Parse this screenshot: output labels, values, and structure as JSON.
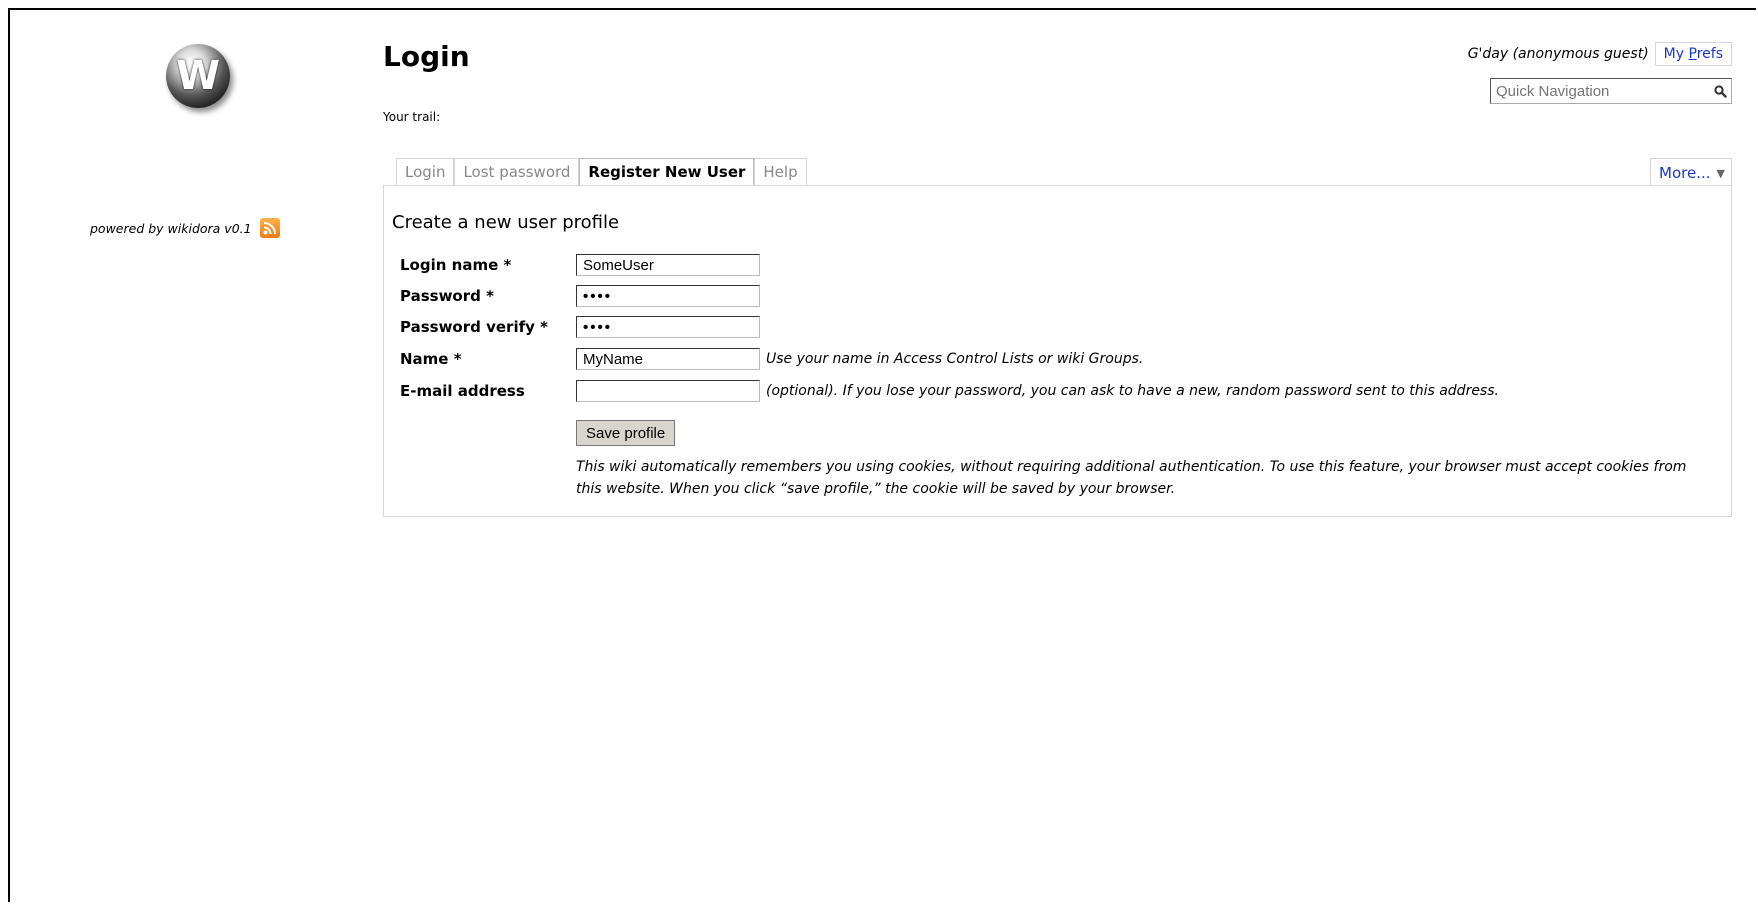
{
  "sidebar": {
    "logo_letter": "W",
    "powered_by": "powered by wikidora v0.1",
    "rss_icon": "rss-feed-icon"
  },
  "header": {
    "title": "Login",
    "trail_label": "Your trail:",
    "greeting": "G'day (anonymous guest)",
    "prefs_prefix": "My ",
    "prefs_underlined": "P",
    "prefs_suffix": "refs",
    "quicknav_placeholder": "Quick Navigation"
  },
  "tabs": [
    {
      "label": "Login",
      "active": false
    },
    {
      "label": "Lost password",
      "active": false
    },
    {
      "label": "Register New User",
      "active": true
    },
    {
      "label": "Help",
      "active": false
    }
  ],
  "more_label": "More...",
  "form": {
    "title": "Create a new user profile",
    "fields": {
      "login_name": {
        "label": "Login name *",
        "value": "SomeUser"
      },
      "password": {
        "label": "Password *",
        "value": "••••"
      },
      "password_verify": {
        "label": "Password verify *",
        "value": "••••"
      },
      "name": {
        "label": "Name *",
        "value": "MyName",
        "hint": "Use your name in Access Control Lists or wiki Groups."
      },
      "email": {
        "label": "E-mail address",
        "value": "",
        "hint": "(optional). If you lose your password, you can ask to have a new, random password sent to this address."
      }
    },
    "save_label": "Save profile",
    "cookie_note": "This wiki automatically remembers you using cookies, without requiring additional authentication. To use this feature, your browser must accept cookies from this website. When you click “save profile,” the cookie will be saved by your browser."
  },
  "colors": {
    "link": "#1a38c8",
    "rss": "#f07a12",
    "button": "#d8d5cc"
  }
}
